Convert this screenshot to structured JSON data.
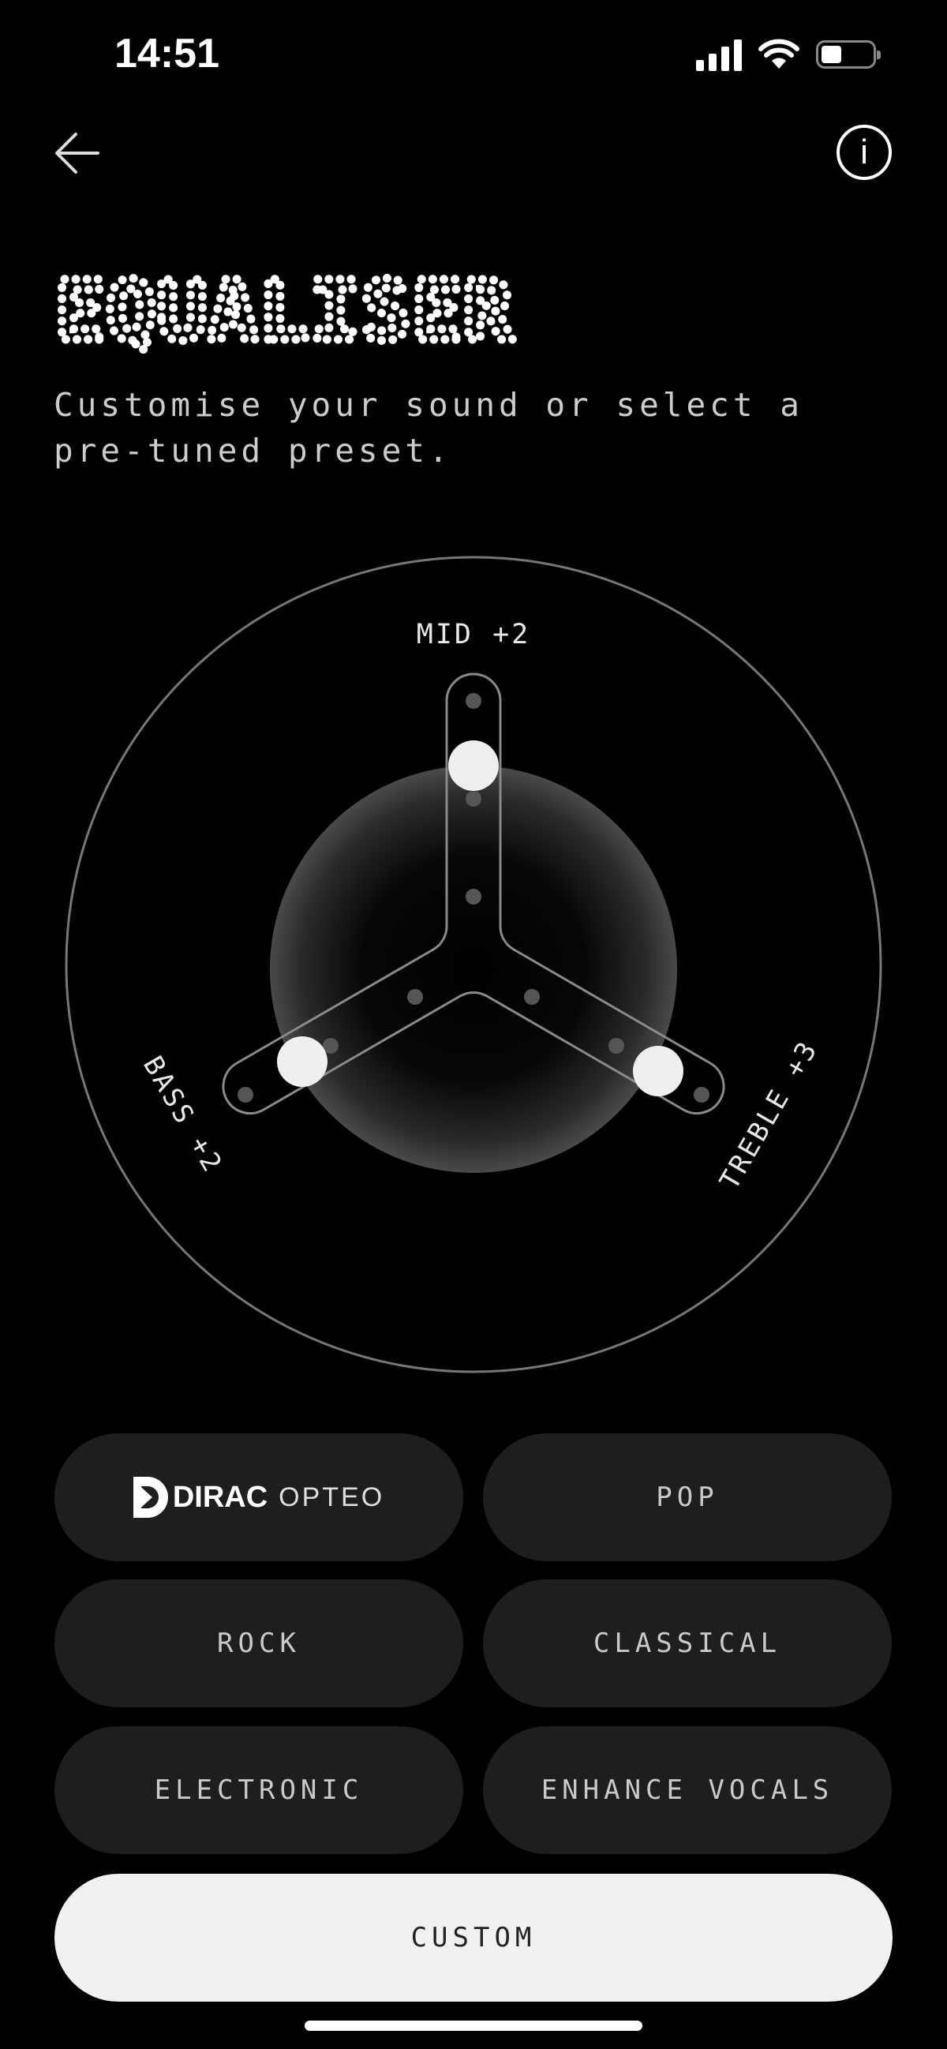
{
  "status_bar": {
    "time": "14:51"
  },
  "header": {
    "back_icon": "arrow-left-icon",
    "info_icon": "info-icon"
  },
  "page": {
    "title": "EQUALISER",
    "subtitle": "Customise your sound or select a pre-tuned preset."
  },
  "equaliser": {
    "mid": {
      "label": "MID +2",
      "value": 2
    },
    "bass": {
      "label": "BASS +2",
      "value": 2
    },
    "treble": {
      "label": "TREBLE +3",
      "value": 3
    }
  },
  "presets": {
    "dirac_brand": "DIRAC",
    "dirac_product": "OPTEO",
    "pop": "POP",
    "rock": "ROCK",
    "classical": "CLASSICAL",
    "electronic": "ELECTRONIC",
    "enhance_vocals": "ENHANCE VOCALS",
    "custom": "CUSTOM",
    "selected": "CUSTOM"
  },
  "colors": {
    "background": "#000000",
    "button": "#1d1e20",
    "selected_button": "#f0f1f0"
  }
}
